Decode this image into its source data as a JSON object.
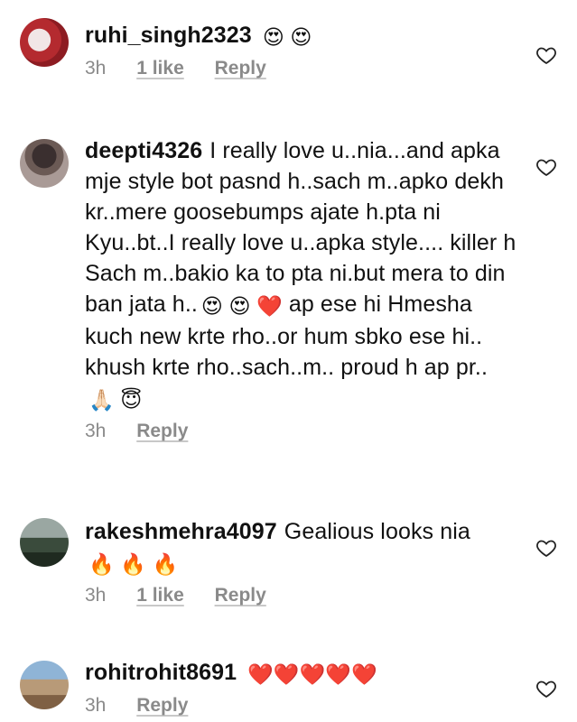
{
  "comments": [
    {
      "username": "ruhi_singh2323",
      "text": "",
      "emoji": "😍 😍",
      "time": "3h",
      "likes": "1 like",
      "reply": "Reply"
    },
    {
      "username": "deepti4326",
      "text": "I really love u..nia...and apka mje style bot pasnd h..sach m..apko dekh kr..mere goosebumps ajate h.pta ni Kyu..bt..I really love u..apka style.... killer h Sach m..bakio ka to pta ni.but mera to din ban jata h..",
      "emoji_mid": "😍 😍 ❤️",
      "text2": "ap ese hi Hmesha kuch new krte rho..or hum sbko ese hi.. khush krte rho..sach..m.. proud h ap pr..",
      "emoji_end": "🙏🏻 😇",
      "time": "3h",
      "reply": "Reply"
    },
    {
      "username": "rakeshmehra4097",
      "text": "Gealious looks nia",
      "emoji": "🔥 🔥 🔥",
      "time": "3h",
      "likes": "1 like",
      "reply": "Reply"
    },
    {
      "username": "rohitrohit8691",
      "text": "",
      "emoji": "❤️❤️❤️❤️❤️",
      "time": "3h",
      "reply": "Reply"
    }
  ],
  "icons": {
    "avatar": "avatar",
    "like": "heart-outline-icon"
  }
}
